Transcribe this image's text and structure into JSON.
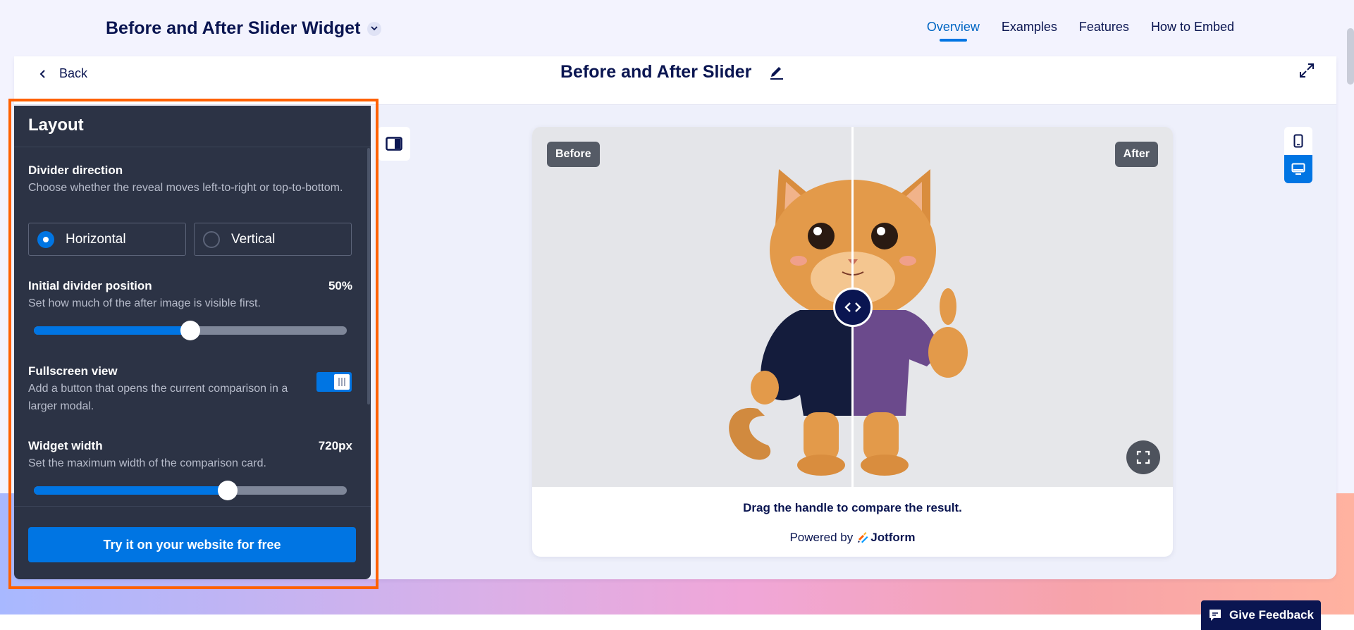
{
  "app": {
    "title": "Before and After Slider Widget"
  },
  "nav": {
    "items": [
      {
        "label": "Overview",
        "active": true
      },
      {
        "label": "Examples",
        "active": false
      },
      {
        "label": "Features",
        "active": false
      },
      {
        "label": "How to Embed",
        "active": false
      }
    ]
  },
  "header": {
    "back_label": "Back",
    "widget_title": "Before and After Slider"
  },
  "panel": {
    "title": "Layout",
    "divider_direction": {
      "title": "Divider direction",
      "desc": "Choose whether the reveal moves left-to-right or top-to-bottom.",
      "options": [
        {
          "label": "Horizontal",
          "selected": true
        },
        {
          "label": "Vertical",
          "selected": false
        }
      ]
    },
    "initial_position": {
      "title": "Initial divider position",
      "value": "50%",
      "fraction": 0.5,
      "desc": "Set how much of the after image is visible first."
    },
    "fullscreen": {
      "title": "Fullscreen view",
      "desc": "Add a button that opens the current comparison in a larger modal.",
      "enabled": true
    },
    "widget_width": {
      "title": "Widget width",
      "value": "720px",
      "fraction": 0.62,
      "desc": "Set the maximum width of the comparison card."
    },
    "cta_label": "Try it on your website for free"
  },
  "preview": {
    "before_label": "Before",
    "after_label": "After",
    "caption": "Drag the handle to compare the result.",
    "powered_by": "Powered by",
    "brand": "Jotform"
  },
  "feedback_label": "Give Feedback",
  "colors": {
    "accent": "#0075e3",
    "navy": "#0a1551",
    "panel_bg": "#2c3345",
    "highlight": "#ff6100"
  },
  "icons": [
    "chevron-down-icon",
    "chevron-left-icon",
    "pencil-icon",
    "expand-icon",
    "panel-toggle-icon",
    "mobile-icon",
    "desktop-icon",
    "code-arrows-icon",
    "fullscreen-icon",
    "feedback-icon",
    "jotform-logo-icon"
  ]
}
